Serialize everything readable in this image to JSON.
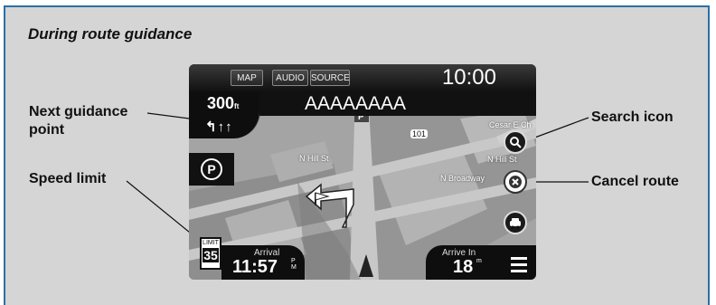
{
  "panel": {
    "title": "During route guidance"
  },
  "callouts": {
    "next_guidance": "Next guidance\npoint",
    "speed_limit": "Speed limit",
    "search_icon": "Search icon",
    "cancel_route": "Cancel route"
  },
  "screen": {
    "buttons": {
      "map": "MAP",
      "audio": "AUDIO",
      "source": "SOURCE"
    },
    "clock": "10:00",
    "next_turn": {
      "distance": "300",
      "distance_unit": "ft",
      "lanes": "↰↑↑"
    },
    "street": "AAAAAAAA",
    "map_labels": {
      "n_hill_st_1": "N Hill St",
      "n_hill_st_2": "N Hill St",
      "n_broadway": "N Broadway",
      "cesar_chavez": "Cesar E Ch",
      "route_shield": "101"
    },
    "parking_icon_text": "P",
    "speed_limit": {
      "label": "LIMIT",
      "value": "35"
    },
    "arrival": {
      "label": "Arrival",
      "value": "11:57",
      "suffix": "PM"
    },
    "arrive_in": {
      "label": "Arrive In",
      "value": "18",
      "suffix": "m"
    }
  },
  "colors": {
    "panel_bg": "#d5d5d5",
    "panel_border": "#2a6fa6",
    "screen_bg": "#000000",
    "map_bg": "#9a9a9a"
  }
}
